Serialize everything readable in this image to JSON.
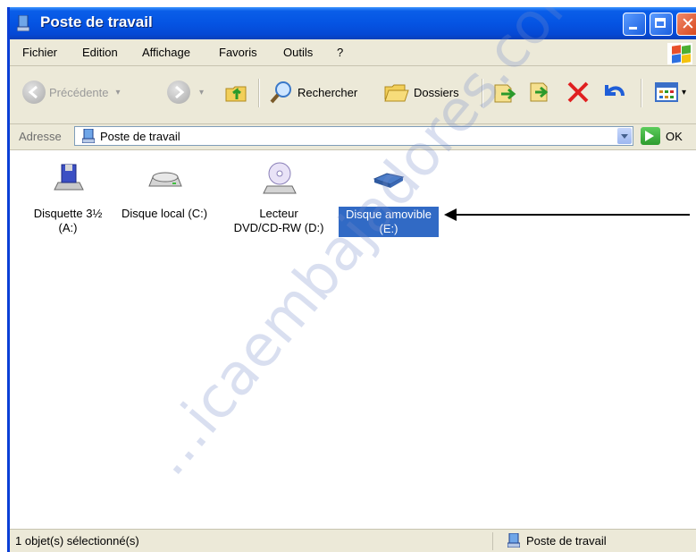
{
  "window": {
    "title": "Poste de travail"
  },
  "menu": {
    "items": [
      {
        "label": "Fichier"
      },
      {
        "label": "Edition"
      },
      {
        "label": "Affichage"
      },
      {
        "label": "Favoris"
      },
      {
        "label": "Outils"
      },
      {
        "label": "?"
      }
    ]
  },
  "toolbar": {
    "back_label": "Précédente",
    "search_label": "Rechercher",
    "folders_label": "Dossiers"
  },
  "address": {
    "label": "Adresse",
    "value": "Poste de travail",
    "go_label": "OK"
  },
  "drives": [
    {
      "label": "Disquette 3½\n(A:)",
      "icon": "floppy-drive-icon"
    },
    {
      "label": "Disque local (C:)",
      "icon": "hard-disk-icon"
    },
    {
      "label": "Lecteur\nDVD/CD-RW (D:)",
      "icon": "dvd-drive-icon"
    },
    {
      "label": "Disque amovible\n(E:)",
      "icon": "removable-disk-icon",
      "selected": true
    }
  ],
  "status": {
    "left": "1 objet(s) sélectionné(s)",
    "right": "Poste de travail"
  },
  "watermark": "...icaembajadores.com",
  "colors": {
    "title_bar": "#0554e3",
    "selection": "#316ac5",
    "chrome": "#ece9d8"
  }
}
